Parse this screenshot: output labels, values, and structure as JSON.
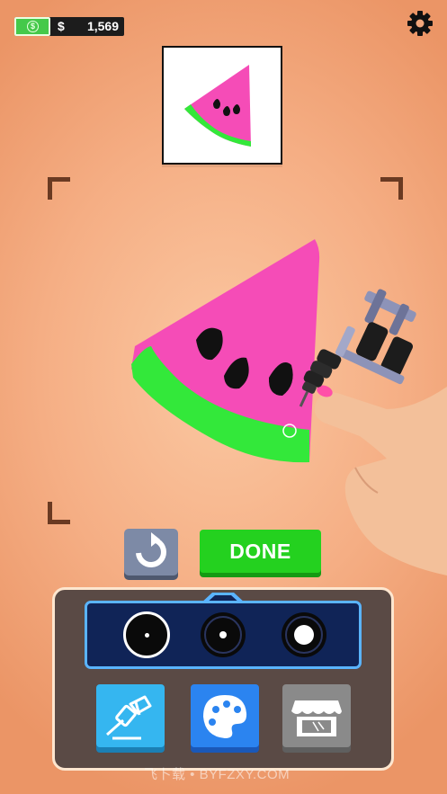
{
  "hud": {
    "currency_symbol": "$",
    "money_amount": "1,569",
    "bill_icon": "dollar-bill-icon",
    "settings_icon": "gear-icon"
  },
  "reference": {
    "design": "watermelon-slice"
  },
  "actions": {
    "done_label": "DONE",
    "reset_icon": "rotate-arrow-icon"
  },
  "needle_sizes": [
    {
      "name": "needle-large",
      "selected": true
    },
    {
      "name": "needle-medium",
      "selected": false
    },
    {
      "name": "needle-fill",
      "selected": false
    }
  ],
  "tools": [
    {
      "name": "tattoo-machine",
      "icon": "tattoo-machine-icon"
    },
    {
      "name": "color-palette",
      "icon": "palette-icon"
    },
    {
      "name": "shop",
      "icon": "shop-icon"
    }
  ],
  "watermark": "飞卜载 • BYFZXY.COM",
  "colors": {
    "watermelon_flesh": "#f54cb7",
    "watermelon_rind": "#33e83a",
    "seed": "#111111",
    "done_green": "#24d11f",
    "needle_bar_border": "#5ab4ff"
  }
}
